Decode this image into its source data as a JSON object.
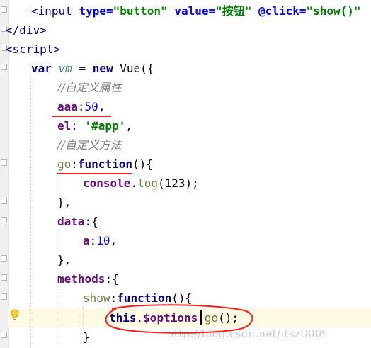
{
  "editor": {
    "lines": {
      "l1": {
        "open": "<",
        "tag": "input",
        "sp1": " ",
        "attr1": "type=",
        "val1": "\"button\"",
        "sp2": " ",
        "attr2": "value=",
        "val2": "\"按钮\"",
        "sp3": " ",
        "attr3": "@click=",
        "val3": "\"show()\""
      },
      "l2": {
        "text": "</div>"
      },
      "l3": {
        "text": "<script>"
      },
      "l4": {
        "kw_var": "var",
        "name": "vm",
        "rest": " = ",
        "kw_new": "new",
        "cls": " Vue({"
      },
      "l5": {
        "comment": "//自定义属性"
      },
      "l6": {
        "prop": "aaa",
        "colon": ":",
        "num": "50",
        "comma": ","
      },
      "l7": {
        "prop": "el",
        "colon": ": ",
        "str": "'#app'",
        "comma": ","
      },
      "l8": {
        "comment": "//自定义方法"
      },
      "l9": {
        "name": "go",
        "colon": ":",
        "kw": "function",
        "rest": "(){"
      },
      "l10": {
        "obj": "console",
        "dot": ".",
        "method": "log",
        "rest": "(123);"
      },
      "l11": {
        "text": "},"
      },
      "l12": {
        "prop": "data",
        "rest": ":{"
      },
      "l13": {
        "prop": "a",
        "colon": ":",
        "num": "10",
        "comma": ","
      },
      "l14": {
        "text": "},"
      },
      "l15": {
        "prop": "methods",
        "rest": ":{"
      },
      "l16": {
        "name": "show",
        "colon": ":",
        "kw": "function",
        "rest": "(){"
      },
      "l17": {
        "this": "this",
        "dot": ".",
        "options": "$options",
        "dot2": ".",
        "method": "go",
        "rest": "();"
      },
      "l18": {
        "text": "}"
      }
    },
    "watermark": "http://blog.csdn.net/itszt888",
    "colors": {
      "annotation_red": "#ff1e1e",
      "highlight_row": "#fffae3",
      "keyword": "#000080",
      "string": "#008000",
      "number": "#0000ff",
      "comment": "#808080",
      "property": "#660e7a"
    },
    "icons": [
      "fold-marker-icon",
      "lightbulb-icon"
    ]
  }
}
